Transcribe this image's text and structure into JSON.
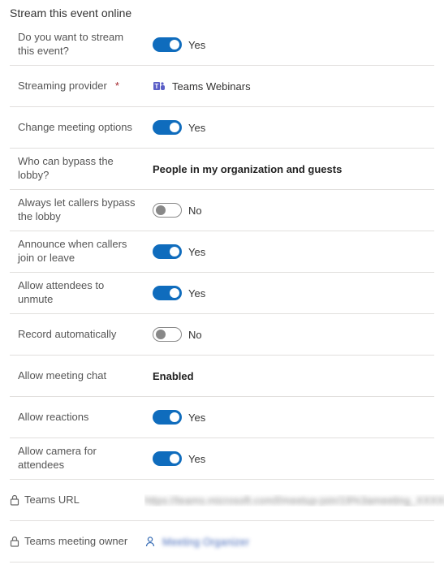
{
  "section_title": "Stream this event online",
  "rows": {
    "stream": {
      "label": "Do you want to stream this event?",
      "state": "Yes"
    },
    "provider": {
      "label": "Streaming provider",
      "required": "*",
      "value": "Teams Webinars"
    },
    "change_options": {
      "label": "Change meeting options",
      "state": "Yes"
    },
    "bypass": {
      "label": "Who can bypass the lobby?",
      "value": "People in my organization and guests"
    },
    "always_bypass": {
      "label": "Always let callers bypass the lobby",
      "state": "No"
    },
    "announce": {
      "label": "Announce when callers join or leave",
      "state": "Yes"
    },
    "unmute": {
      "label": "Allow attendees to unmute",
      "state": "Yes"
    },
    "record": {
      "label": "Record automatically",
      "state": "No"
    },
    "chat": {
      "label": "Allow meeting chat",
      "value": "Enabled"
    },
    "reactions": {
      "label": "Allow reactions",
      "state": "Yes"
    },
    "camera": {
      "label": "Allow camera for attendees",
      "state": "Yes"
    },
    "url": {
      "label": "Teams URL",
      "value": "https://teams.microsoft.com/l/meetup-join/19%3ameeting_XXXXXXXXXXXXXX"
    },
    "owner": {
      "label": "Teams meeting owner",
      "value": "Meeting Organizer"
    }
  }
}
